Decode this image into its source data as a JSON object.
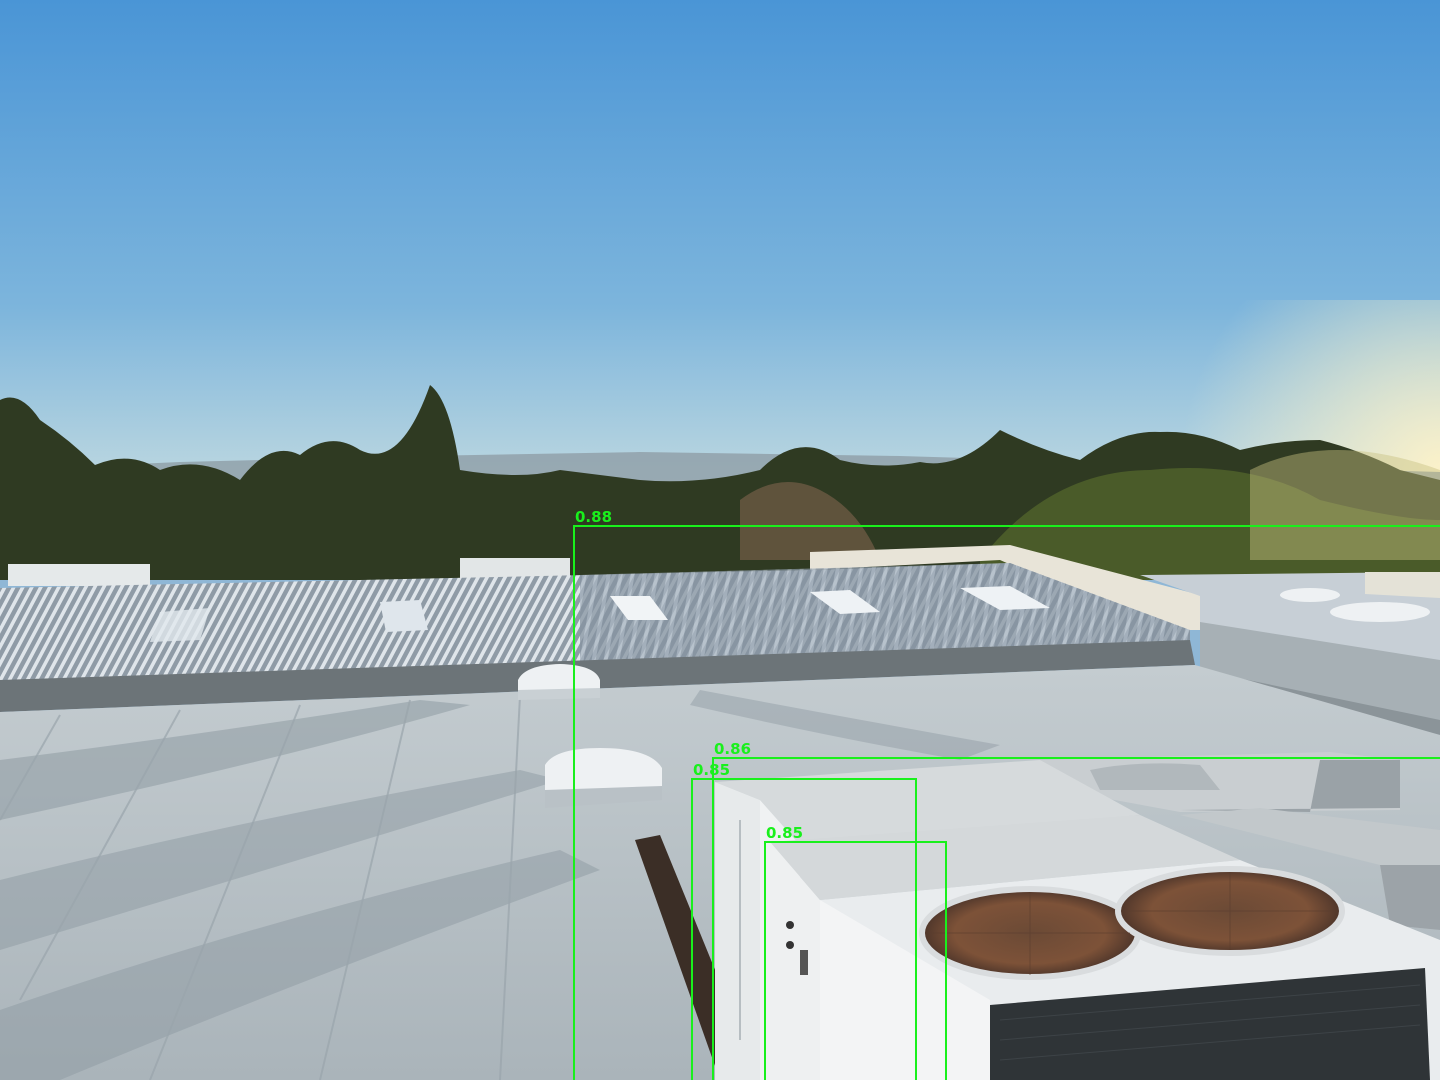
{
  "scene": {
    "description_icon": "rooftop-hvac-photo",
    "colors": {
      "sky_top": "#4f97d6",
      "sky_bottom": "#d8e6e2",
      "roof": "#b7c2c8",
      "detection_box": "#19f01c"
    }
  },
  "detections": [
    {
      "score": "0.88"
    },
    {
      "score": "0.86"
    },
    {
      "score": "0.85"
    },
    {
      "score": "0.85"
    }
  ]
}
